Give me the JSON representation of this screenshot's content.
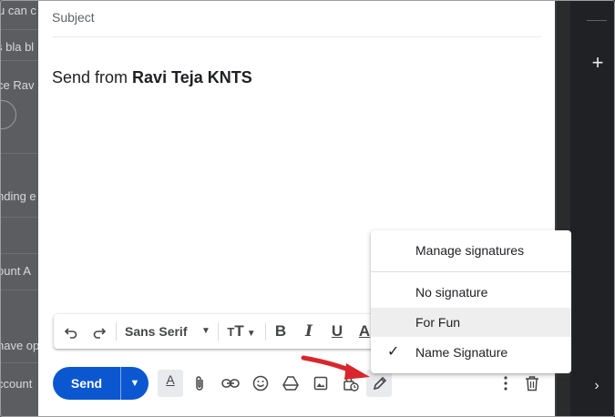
{
  "background_list": {
    "snippets": [
      "u can c",
      "s bla bl",
      "ce Rav",
      "nding e",
      "ount A",
      "have op",
      "ccount"
    ]
  },
  "compose": {
    "subject_placeholder": "Subject",
    "body_prefix": "Send from ",
    "body_name": "Ravi Teja KNTS"
  },
  "format_toolbar": {
    "font": "Sans Serif"
  },
  "bottom_bar": {
    "send_label": "Send"
  },
  "signature_menu": {
    "items": [
      {
        "label": "Manage signatures",
        "checked": false,
        "highlighted": false
      },
      {
        "label": "No signature",
        "checked": false,
        "highlighted": false
      },
      {
        "label": "For Fun",
        "checked": false,
        "highlighted": true
      },
      {
        "label": "Name Signature",
        "checked": true,
        "highlighted": false
      }
    ]
  },
  "colors": {
    "send_blue": "#0b57d0",
    "annotation_arrow": "#d8262c",
    "right_pane": "#202124"
  }
}
